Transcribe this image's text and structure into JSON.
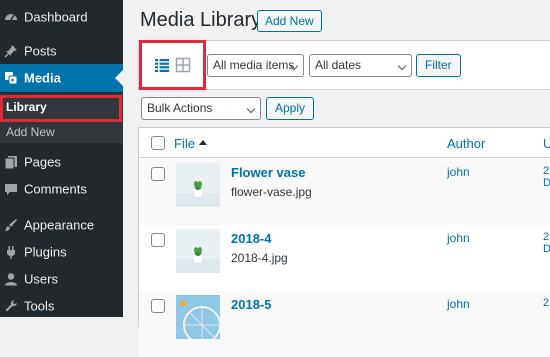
{
  "sidebar": {
    "items": [
      {
        "name": "Dashboard",
        "icon": "dashboard-icon"
      },
      {
        "name": "Posts",
        "icon": "pin-icon"
      },
      {
        "name": "Media",
        "icon": "media-icon"
      },
      {
        "name": "Pages",
        "icon": "page-icon"
      },
      {
        "name": "Comments",
        "icon": "comment-icon"
      },
      {
        "name": "Appearance",
        "icon": "brush-icon"
      },
      {
        "name": "Plugins",
        "icon": "plugin-icon"
      },
      {
        "name": "Users",
        "icon": "user-icon"
      },
      {
        "name": "Tools",
        "icon": "wrench-icon"
      }
    ],
    "submenu": {
      "library": "Library",
      "add_new": "Add New"
    }
  },
  "header": {
    "title": "Media Library",
    "add_new": "Add New"
  },
  "filters": {
    "media_items": "All media items",
    "dates": "All dates",
    "filter_button": "Filter"
  },
  "bulk": {
    "label": "Bulk Actions",
    "apply": "Apply"
  },
  "table": {
    "headers": {
      "file": "File",
      "author": "Author",
      "uploaded": "U"
    },
    "rows": [
      {
        "title": "Flower vase",
        "filename": "flower-vase.jpg",
        "author": "john",
        "uploaded_cut": "2\nD"
      },
      {
        "title": "2018-4",
        "filename": "2018-4.jpg",
        "author": "john",
        "uploaded_cut": "2\nD"
      },
      {
        "title": "2018-5",
        "filename": "",
        "author": "john",
        "uploaded_cut": "2"
      }
    ]
  },
  "colors": {
    "sidebar_bg": "#23282d",
    "active_bg": "#0073aa",
    "link": "#0073aa",
    "highlight": "#dd2b39"
  }
}
